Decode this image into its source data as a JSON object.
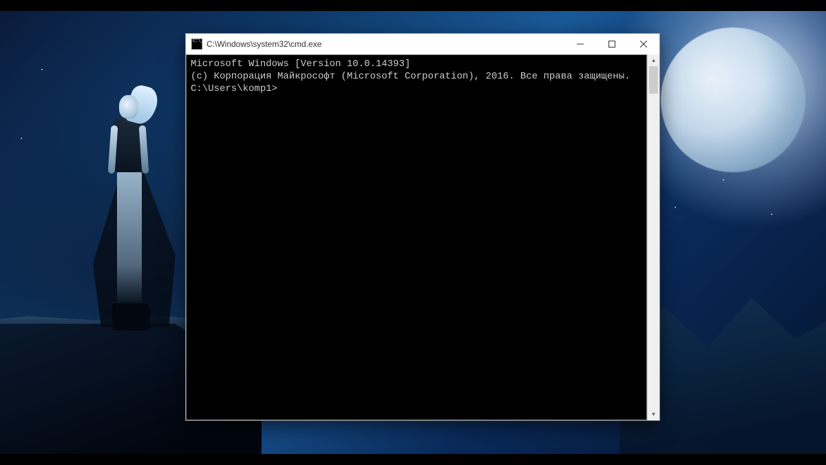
{
  "window": {
    "title": "C:\\Windows\\system32\\cmd.exe"
  },
  "console": {
    "line1": "Microsoft Windows [Version 10.0.14393]",
    "line2": "(c) Корпорация Майкрософт (Microsoft Corporation), 2016. Все права защищены.",
    "blank": "",
    "prompt": "C:\\Users\\komp1>"
  }
}
